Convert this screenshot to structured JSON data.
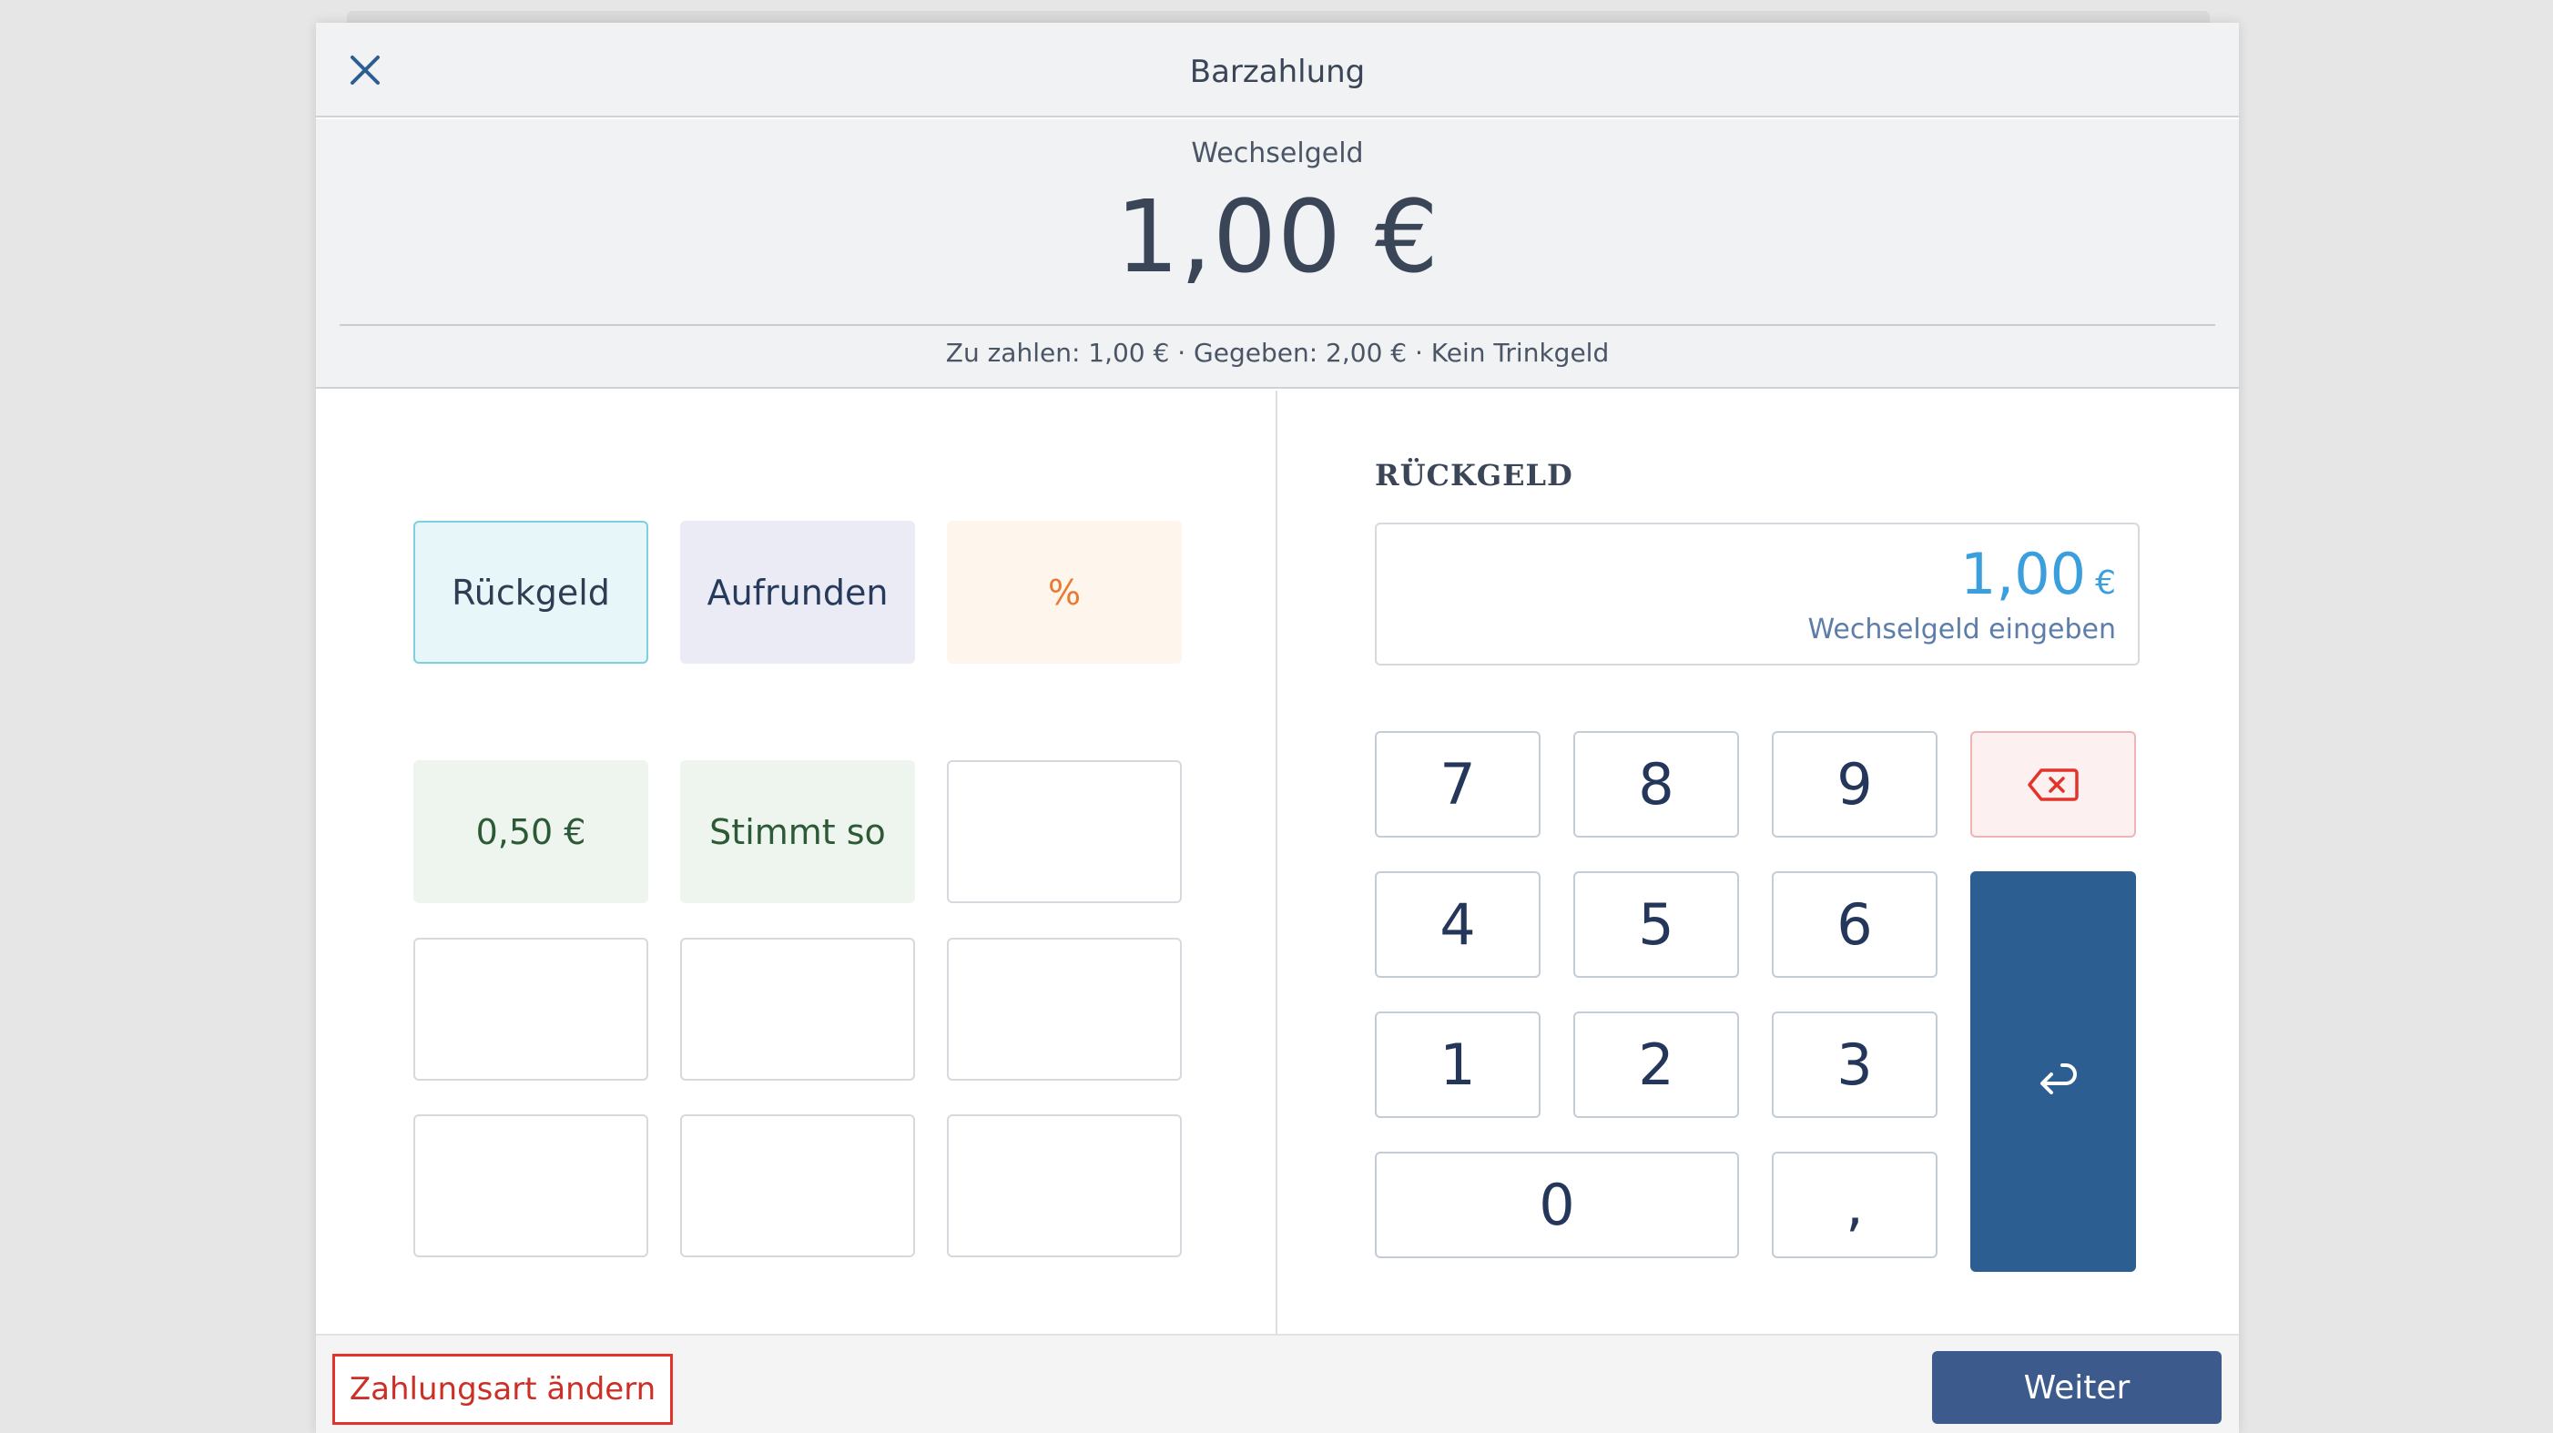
{
  "header": {
    "title": "Barzahlung",
    "close_icon": "close-icon"
  },
  "summary": {
    "label": "Wechselgeld",
    "amount": "1,00 €",
    "detail": "Zu zahlen: 1,00 € · Gegeben: 2,00 € · Kein Trinkgeld"
  },
  "quick": {
    "mode_buttons": [
      "Rückgeld",
      "Aufrunden",
      "%"
    ],
    "amount_buttons": [
      "0,50 €",
      "Stimmt so"
    ]
  },
  "input": {
    "label": "RÜCKGELD",
    "value": "1,00",
    "currency": "€",
    "hint": "Wechselgeld eingeben"
  },
  "keypad": {
    "digits": [
      "7",
      "8",
      "9",
      "4",
      "5",
      "6",
      "1",
      "2",
      "3",
      "0",
      ","
    ],
    "backspace_icon": "backspace-icon",
    "enter_icon": "enter-icon"
  },
  "footer": {
    "change_payment": "Zahlungsart ändern",
    "next": "Weiter"
  },
  "colors": {
    "accent_blue": "#3b9fde",
    "primary": "#2c5e91",
    "danger": "#e2342a",
    "tile_rueckgeld_bg": "#e7f6f9",
    "tile_aufrunden_bg": "#ebebf6",
    "tile_percent_bg": "#fef5ec",
    "tile_amount_bg": "#eef5ee"
  }
}
